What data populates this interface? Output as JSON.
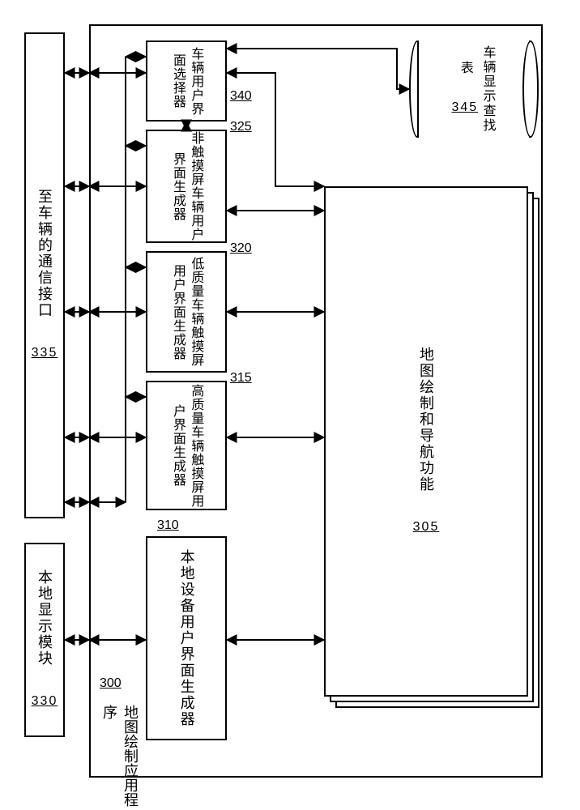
{
  "diagram": {
    "outer": {
      "label": "地图绘制应用程序",
      "num": "300"
    },
    "external": {
      "local_display": {
        "label": "本地显示模块",
        "num": "330"
      },
      "comm_interface": {
        "label": "至车辆的通信接口",
        "num": "335"
      }
    },
    "generators": {
      "local_device": {
        "label": "本地设备用户界面生成器",
        "num": "310"
      },
      "hq_touch": {
        "label": "高质量车辆触摸屏用户界面生成器",
        "num": "315"
      },
      "lq_touch": {
        "label": "低质量车辆触摸屏用户界面生成器",
        "num": "320"
      },
      "non_touch": {
        "label": "非触摸屏车辆用户界面生成器",
        "num": "325"
      }
    },
    "selector": {
      "label": "车辆用户界面选择器",
      "num": "340"
    },
    "map_nav": {
      "label": "地图绘制和导航功能",
      "num": "305"
    },
    "lookup": {
      "label": "车辆显示查找表",
      "num": "345"
    }
  }
}
